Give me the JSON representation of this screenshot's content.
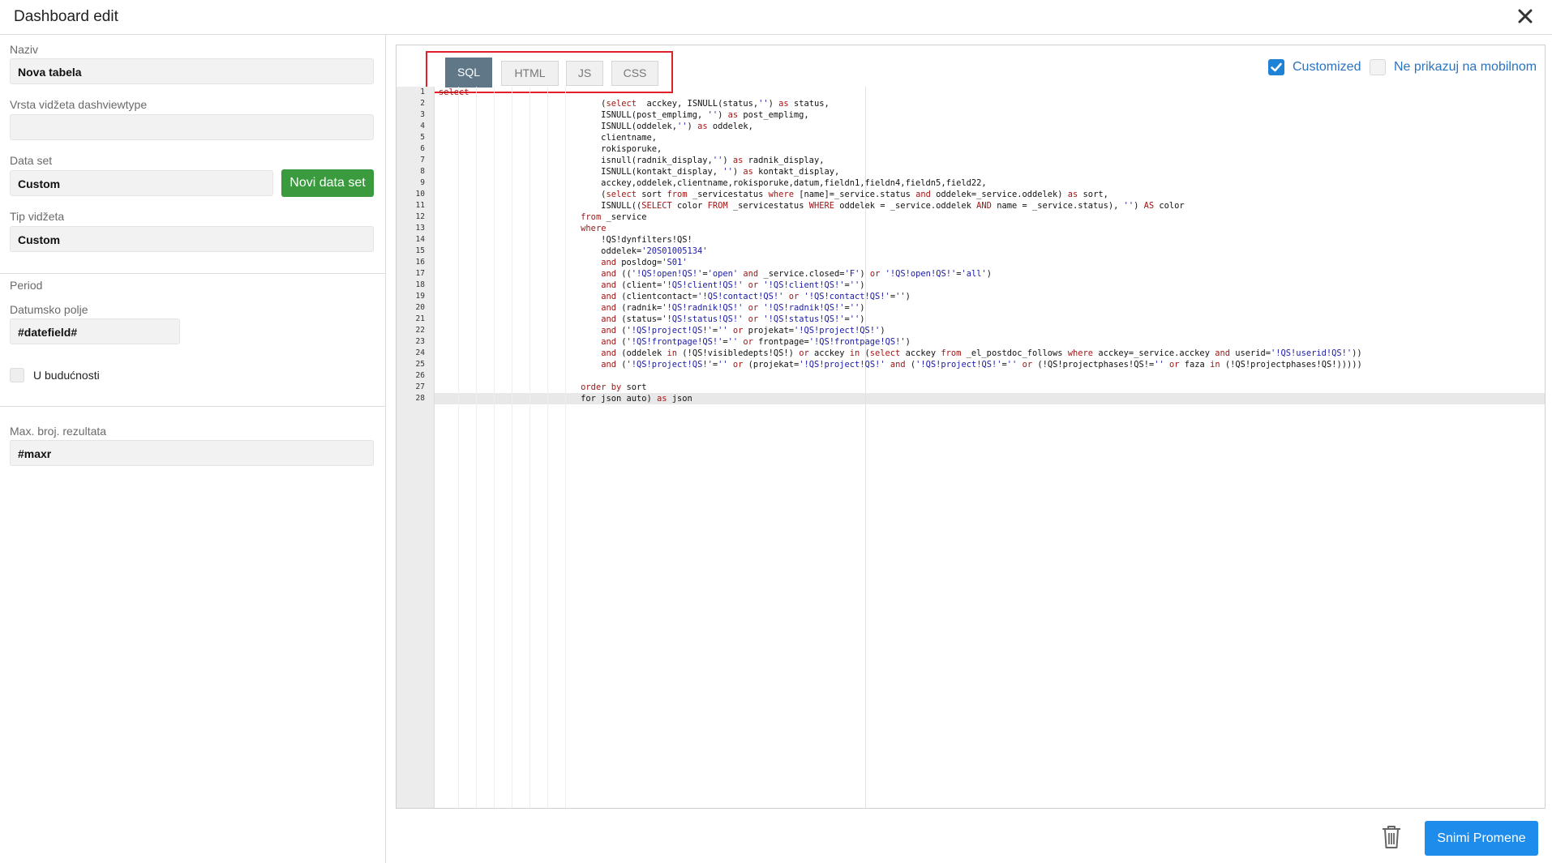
{
  "window": {
    "title": "Dashboard edit",
    "close_icon": "close-icon"
  },
  "form": {
    "naziv_label": "Naziv",
    "naziv_value": "Nova tabela",
    "vrsta_label": "Vrsta vidžeta dashviewtype",
    "vrsta_value": "",
    "dataset_label": "Data set",
    "dataset_value": "Custom",
    "new_dataset_button": "Novi data set",
    "tip_label": "Tip vidžeta",
    "tip_value": "Custom",
    "period_label": "Period",
    "datumsko_label": "Datumsko polje",
    "datumsko_value": "#datefield#",
    "future_label": "U budućnosti",
    "future_checked": false,
    "max_label": "Max. broj. rezultata",
    "max_value": "#maxr"
  },
  "editor": {
    "tabs": [
      {
        "label": "SQL",
        "active": true
      },
      {
        "label": "HTML",
        "active": false
      },
      {
        "label": "JS",
        "active": false
      },
      {
        "label": "CSS",
        "active": false
      }
    ],
    "customized_label": "Customized",
    "customized_checked": true,
    "mobile_label": "Ne prikazuj na mobilnom",
    "mobile_checked": false,
    "lines": [
      "select",
      "                                (select  acckey, ISNULL(status,'') as status,",
      "                                ISNULL(post_emplimg, '') as post_emplimg,",
      "                                ISNULL(oddelek,'') as oddelek,",
      "                                clientname,",
      "                                rokisporuke,",
      "                                isnull(radnik_display,'') as radnik_display,",
      "                                ISNULL(kontakt_display, '') as kontakt_display,",
      "                                acckey,oddelek,clientname,rokisporuke,datum,fieldn1,fieldn4,fieldn5,field22,",
      "                                (select sort from _servicestatus where [name]=_service.status and oddelek=_service.oddelek) as sort,",
      "                                ISNULL((SELECT color FROM _servicestatus WHERE oddelek = _service.oddelek AND name = _service.status), '') AS color",
      "                            from _service",
      "                            where",
      "                                !QS!dynfilters!QS!",
      "                                oddelek='20S01005134'",
      "                                and posldog='S01'",
      "                                and (('!QS!open!QS!'='open' and _service.closed='F') or '!QS!open!QS!'='all')",
      "                                and (client='!QS!client!QS!' or '!QS!client!QS!'='')",
      "                                and (clientcontact='!QS!contact!QS!' or '!QS!contact!QS!'='')",
      "                                and (radnik='!QS!radnik!QS!' or '!QS!radnik!QS!'='')",
      "                                and (status='!QS!status!QS!' or '!QS!status!QS!'='')",
      "                                and ('!QS!project!QS!'='' or projekat='!QS!project!QS!')",
      "                                and ('!QS!frontpage!QS!'='' or frontpage='!QS!frontpage!QS!')",
      "                                and (oddelek in (!QS!visibledepts!QS!) or acckey in (select acckey from _el_postdoc_follows where acckey=_service.acckey and userid='!QS!userid!QS!'))",
      "                                and ('!QS!project!QS!'='' or (projekat='!QS!project!QS!' and ('!QS!project!QS!'='' or (!QS!projectphases!QS!='' or faza in (!QS!projectphases!QS!)))))",
      "",
      "                            order by sort",
      "                            for json auto) as json"
    ]
  },
  "footer": {
    "delete_icon": "trash-icon",
    "save_button": "Snimi Promene"
  }
}
